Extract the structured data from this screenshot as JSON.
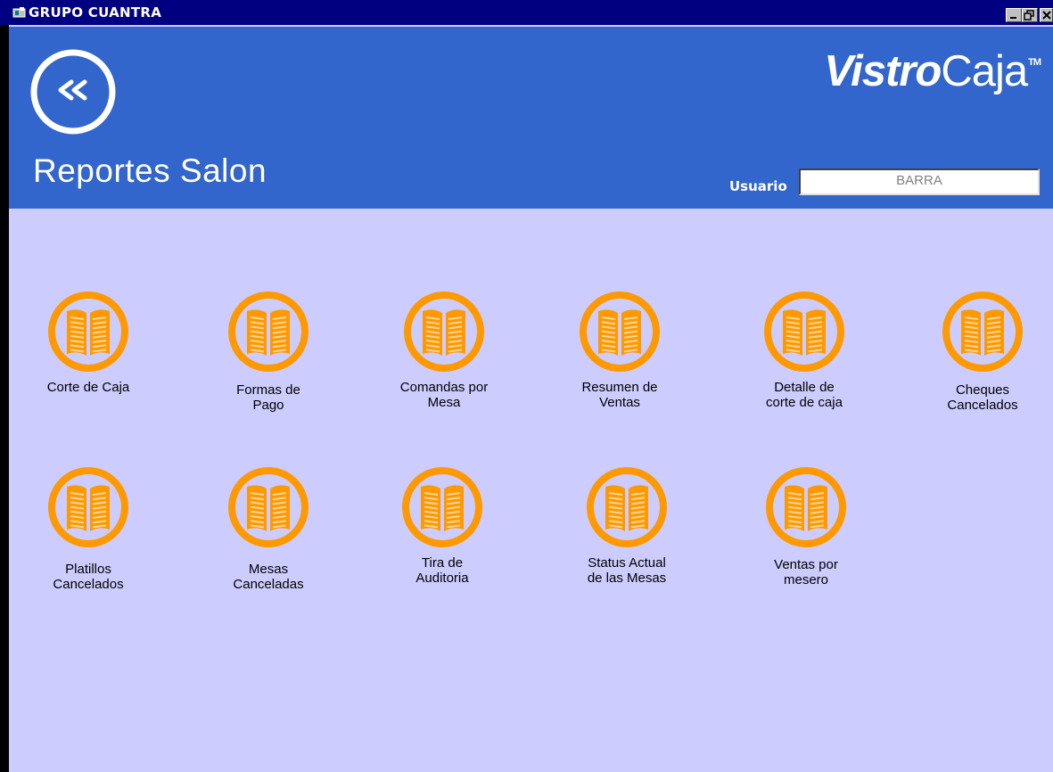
{
  "window": {
    "title": "GRUPO CUANTRA"
  },
  "header": {
    "logo_bold": "Vistro",
    "logo_light": "Caja",
    "logo_tm": "TM",
    "page_title": "Reportes Salon",
    "user_label": "Usuario",
    "user_value": "BARRA"
  },
  "reports": [
    {
      "label": "Corte de Caja"
    },
    {
      "label": "Formas de\nPago"
    },
    {
      "label": "Comandas por\nMesa"
    },
    {
      "label": "Resumen de\nVentas"
    },
    {
      "label": "Detalle de\ncorte de caja"
    },
    {
      "label": "Cheques\nCancelados"
    },
    {
      "label": "Platillos\nCancelados"
    },
    {
      "label": "Mesas\nCanceladas"
    },
    {
      "label": "Tira de\nAuditoria"
    },
    {
      "label": "Status Actual\nde las Mesas"
    },
    {
      "label": "Ventas por\nmesero"
    }
  ],
  "colors": {
    "header_blue": "#3366cc",
    "body_lavender": "#ccccff",
    "icon_orange": "#ff9900",
    "titlebar_navy": "#000080"
  },
  "icons": {
    "back": "double-chevron-left-icon",
    "report": "open-book-icon"
  }
}
